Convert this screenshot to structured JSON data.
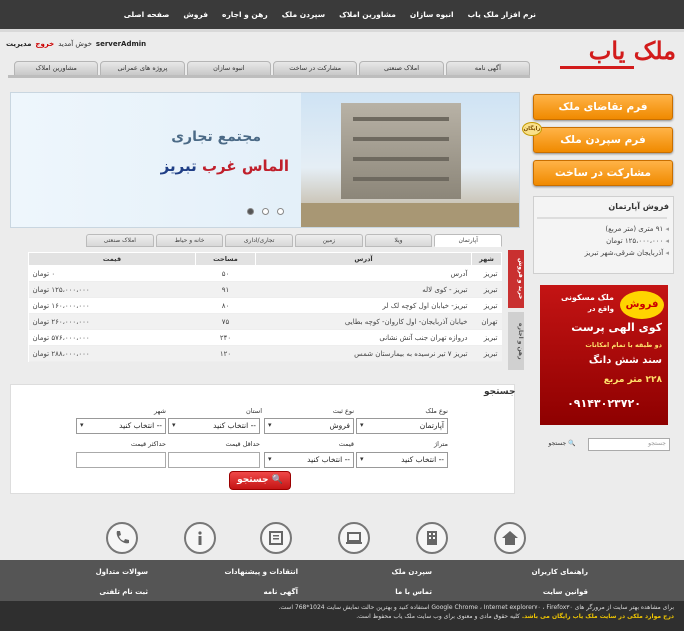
{
  "topnav": [
    "صفحه اصلی",
    "فروش",
    "رهن و اجاره",
    "سپردن ملک",
    "مشاورین املاک",
    "انبوه سازان",
    "نرم افزار ملک یاب"
  ],
  "header": {
    "logo": "ملک یاب",
    "manage": "مدیریت",
    "logout": "خروج",
    "welcome": "خوش آمدید",
    "username": "serverAdmin"
  },
  "tabs": [
    "آگهی نامه",
    "املاک صنعتی",
    "مشارکت در ساخت",
    "انبوه سازان",
    "پروژه های عمرانی",
    "مشاورین املاک"
  ],
  "banner": {
    "line1": "مجتمع تجاری",
    "line2a": "الماس غرب",
    "line2b": "تبریز"
  },
  "actions": {
    "request": "فرم تقاضای ملک",
    "deposit": "فرم سپردن ملک",
    "free": "رایگان",
    "partner": "مشارکت در ساخت"
  },
  "sale_box": {
    "title": "فروش آپارتمان",
    "items": [
      "۹۱ متری (متر مربع)",
      "۱۲۵،۰۰۰،۰۰۰ تومان",
      "آذربایجان شرقی،شهر تبریز"
    ]
  },
  "ad": {
    "burst": "فروش",
    "l1": "ملک مسکونی",
    "l2": "واقع در",
    "l3": "کوی الهی پرست",
    "l4": "دو طبقه با تمام امکانات",
    "l5": "سند شش دانگ",
    "l6": "۲۲۸ متر مربع",
    "phone": "۰۹۱۴۳۰۲۳۷۲۰"
  },
  "side_search": {
    "placeholder": "جستجو",
    "button": "جستجو"
  },
  "listing": {
    "tabs": [
      "آپارتمان",
      "ویلا",
      "زمین",
      "تجاری/اداری",
      "خانه و حیاط",
      "املاک صنعتی"
    ],
    "side_tabs": [
      "خرید و فروش",
      "رهن و اجاره"
    ],
    "headers": [
      "شهر",
      "آدرس",
      "مساحت",
      "قیمت"
    ],
    "rows": [
      [
        "تبریز",
        "آدرس",
        "۵۰",
        "۰ تومان"
      ],
      [
        "تبریز",
        "تبریز - کوی لاله",
        "۹۱",
        "۱۲۵،۰۰۰،۰۰۰ تومان"
      ],
      [
        "تبریز",
        "تبریز- خیابان اول کوچه لک لر",
        "۸۰",
        "۱۶۰،۰۰۰،۰۰۰ تومان"
      ],
      [
        "تهران",
        "خیابان آذربایجان- اول کاروان- کوچه بطایی",
        "۷۵",
        "۲۶۰،۰۰۰،۰۰۰ تومان"
      ],
      [
        "تبریز",
        "دروازه تهران جنب آتش نشانی",
        "۲۴۰",
        "۵۷۶،۰۰۰،۰۰۰ تومان"
      ],
      [
        "تبریز",
        "تبریز ۷ تیر نرسیده به بیمارستان شمس",
        "۱۲۰",
        "۲۸۸،۰۰۰،۰۰۰ تومان"
      ]
    ]
  },
  "search_form": {
    "title": "جستجو",
    "labels": {
      "type": "نوع ملک",
      "deal": "نوع ثبت",
      "province": "استان",
      "city": "شهر",
      "meter": "متراژ",
      "price": "قیمت",
      "min_price": "حداقل قیمت",
      "max_price": "حداکثر قیمت"
    },
    "values": {
      "type": "آپارتمان",
      "deal": "فروش",
      "select": "-- انتخاب کنید"
    },
    "submit": "جستجو"
  },
  "icons": [
    "home-icon",
    "building-icon",
    "laptop-icon",
    "list-icon",
    "info-icon",
    "phone-icon"
  ],
  "footer": {
    "links": [
      "راهنمای کاربران",
      "سپردن ملک",
      "انتقادات و پیشنهادات",
      "سوالات متداول",
      "قوانین سایت",
      "تماس با ما",
      "آگهی نامه",
      "ثبت نام تلفنی"
    ],
    "note1": "برای مشاهده بهتر سایت از مرورگر های Google Chrome ، Internet explorer۷۰ ، Firefox۳۰ استفاده کنید و بهترین حالت نمایش سایت 1024*768 است.",
    "note2": "درج موارد ملکی در سایت ملک یاب رایگان می باشد.",
    "note3": "کلیه حقوق مادی و معنوی برای وب سایت ملک یاب محفوظ است."
  }
}
